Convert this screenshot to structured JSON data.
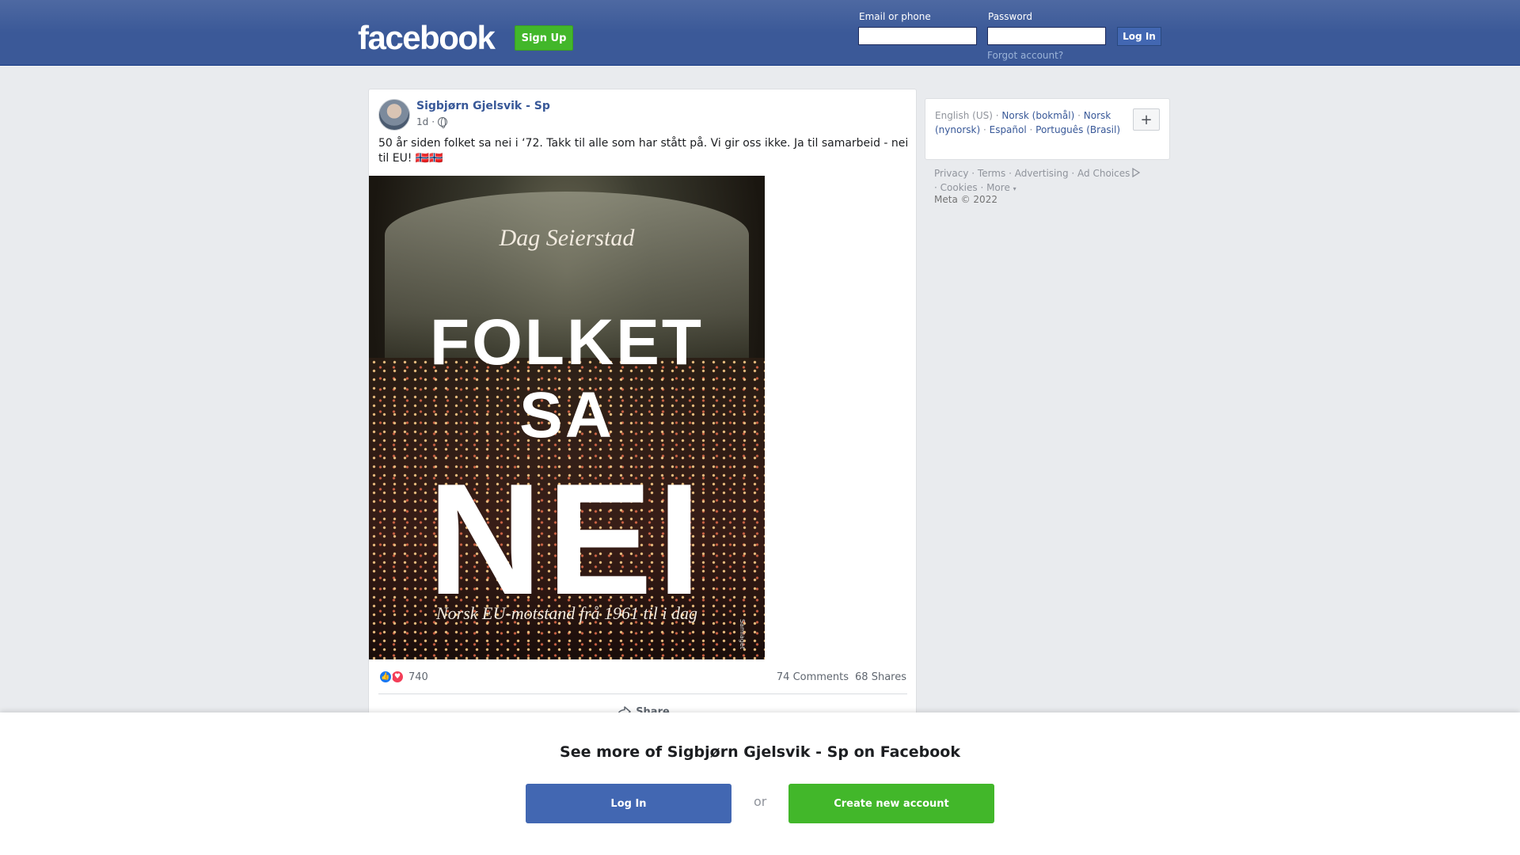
{
  "header": {
    "logo": "facebook",
    "signup_label": "Sign Up",
    "email_label": "Email or phone",
    "password_label": "Password",
    "login_label": "Log In",
    "forgot_label": "Forgot account?",
    "email_value": "",
    "password_value": ""
  },
  "post": {
    "author": "Sigbjørn Gjelsvik - Sp",
    "time": "1d",
    "separator": "·",
    "text": "50 år siden folket sa nei i ‘72. Takk til alle som har stått på. Vi gir oss ikke. Ja til samarbeid - nei til EU! 🇳🇴🇳🇴",
    "image": {
      "author": "Dag Seierstad",
      "title_line1": "FOLKET",
      "title_line2": "SA",
      "title_line3": "NEI",
      "subtitle": "Norsk EU-motstand frå 1961 til i dag",
      "publisher": "Samlaget"
    },
    "reaction_count": "740",
    "comments": "74 Comments",
    "shares": "68 Shares",
    "share_label": "Share"
  },
  "sidebar": {
    "current_language": "English (US)",
    "languages": [
      "Norsk (bokmål)",
      "Norsk (nynorsk)",
      "Español",
      "Português (Brasil)"
    ],
    "plus_label": "+",
    "footer": {
      "privacy": "Privacy",
      "terms": "Terms",
      "advertising": "Advertising",
      "ad_choices": "Ad Choices",
      "cookies": "Cookies",
      "more": "More"
    },
    "copyright": "Meta © 2022"
  },
  "banner": {
    "title": "See more of Sigbjørn Gjelsvik - Sp on Facebook",
    "login_label": "Log In",
    "or_label": "or",
    "create_label": "Create new account"
  },
  "colors": {
    "brand_blue": "#3b5998",
    "link_blue": "#385898",
    "button_blue": "#4267b2",
    "green": "#42b72a",
    "background": "#e9ebee"
  },
  "icons": {
    "globe": "globe-icon",
    "share": "share-icon",
    "like": "like-reaction-icon",
    "love": "love-reaction-icon",
    "ad_choices": "ad-choices-icon",
    "more_caret": "caret-down-icon"
  }
}
